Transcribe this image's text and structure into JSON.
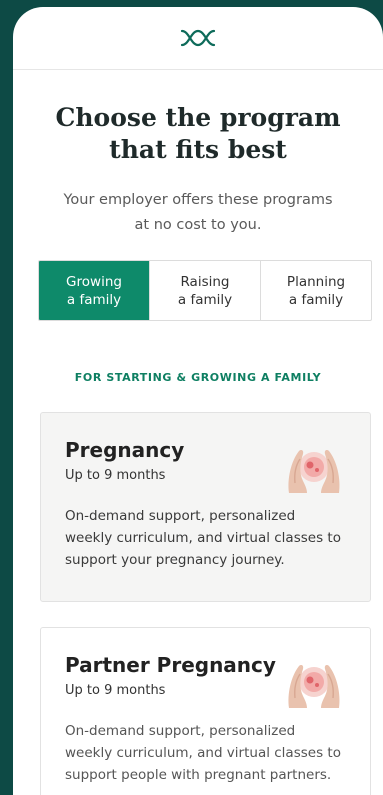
{
  "header": {
    "logo_icon": "linked-loops-logo-icon"
  },
  "hero": {
    "title": "Choose the program that fits best",
    "subtitle": "Your employer offers these programs at no cost to you."
  },
  "tabs": [
    {
      "line1": "Growing",
      "line2": "a family",
      "active": true
    },
    {
      "line1": "Raising",
      "line2": "a family",
      "active": false
    },
    {
      "line1": "Planning",
      "line2": "a family",
      "active": false
    }
  ],
  "section": {
    "label": "FOR STARTING & GROWING A FAMILY"
  },
  "programs": [
    {
      "title": "Pregnancy",
      "duration": "Up to 9 months",
      "description": "On-demand support, personalized weekly curriculum, and virtual classes to support your pregnancy journey.",
      "icon": "hands-embrace-icon"
    },
    {
      "title": "Partner Pregnancy",
      "duration": "Up to 9 months",
      "description": "On-demand support, personalized weekly curriculum, and virtual classes to support people with pregnant partners.",
      "icon": "hands-embrace-icon"
    }
  ],
  "colors": {
    "background": "#0d4a45",
    "accent": "#0e8a6a",
    "section_label": "#0e7f62"
  }
}
